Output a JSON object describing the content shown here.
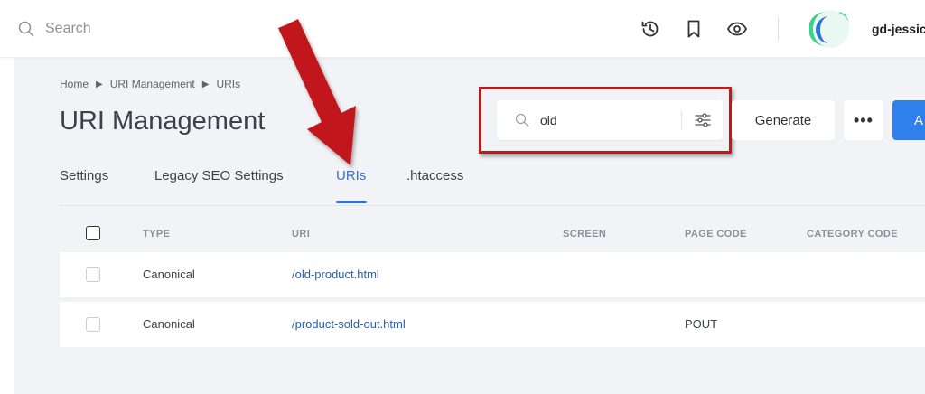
{
  "topbar": {
    "search_placeholder": "Search",
    "username": "gd-jessic",
    "icons": [
      "history-icon",
      "bookmark-icon",
      "eye-icon"
    ]
  },
  "breadcrumb": [
    "Home",
    "URI Management",
    "URIs"
  ],
  "page": {
    "title": "URI Management",
    "filter_value": "old",
    "generate_label": "Generate",
    "more_label": "•••",
    "add_label": "A"
  },
  "tabs": [
    {
      "label": "Settings"
    },
    {
      "label": "Legacy SEO Settings"
    },
    {
      "label": "URIs",
      "active": true
    },
    {
      "label": ".htaccess"
    }
  ],
  "table": {
    "columns": [
      "TYPE",
      "URI",
      "SCREEN",
      "PAGE CODE",
      "CATEGORY CODE"
    ],
    "rows": [
      {
        "type": "Canonical",
        "uri": "/old-product.html",
        "screen": "",
        "page_code": "",
        "category_code": ""
      },
      {
        "type": "Canonical",
        "uri": "/product-sold-out.html",
        "screen": "",
        "page_code": "POUT",
        "category_code": ""
      }
    ]
  },
  "colors": {
    "accent": "#2f72dd",
    "primary_button": "#2f80ed",
    "annotation": "#b81c1c",
    "background": "#f1f3f6"
  }
}
